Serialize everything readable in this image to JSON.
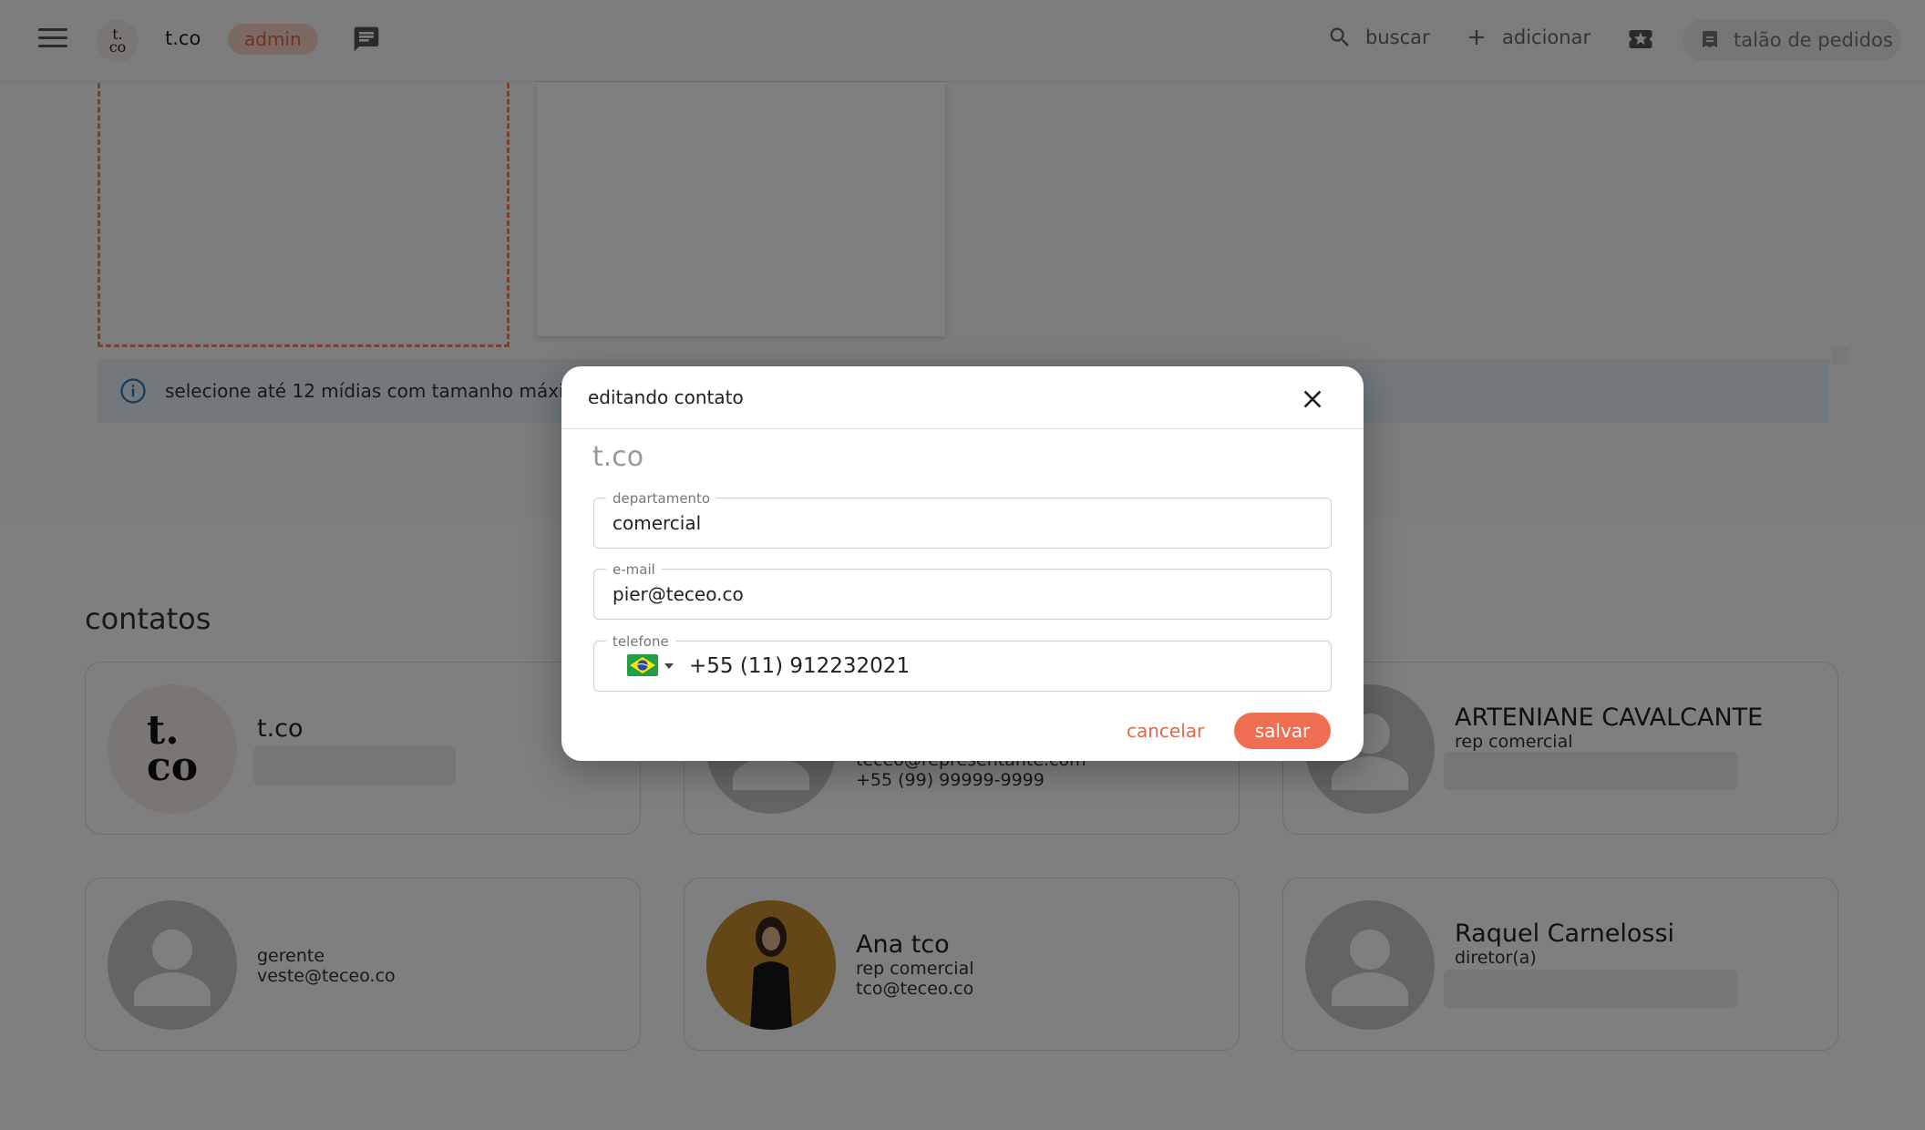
{
  "header": {
    "logo": "t.\nco",
    "brand": "t.co",
    "role_badge": "admin",
    "search_label": "buscar",
    "add_label": "adicionar",
    "orders_label": "talão de pedidos"
  },
  "upload": {
    "info_text": "selecione até 12 mídias com tamanho máximo"
  },
  "contacts": {
    "title": "contatos",
    "cards": [
      {
        "name": "t.co",
        "role": "",
        "email": "",
        "phone": ""
      },
      {
        "name": "",
        "role": "",
        "email": "teceo@representante.com",
        "phone": "+55 (99) 99999-9999"
      },
      {
        "name": "ARTENIANE CAVALCANTE",
        "role": "rep comercial",
        "email": "",
        "phone": ""
      },
      {
        "name": "",
        "role": "gerente",
        "email": "veste@teceo.co",
        "phone": ""
      },
      {
        "name": "Ana tco",
        "role": "rep comercial",
        "email": "tco@teceo.co",
        "phone": ""
      },
      {
        "name": "Raquel Carnelossi",
        "role": "diretor(a)",
        "email": "",
        "phone": ""
      }
    ]
  },
  "dialog": {
    "title": "editando contato",
    "org": "t.co",
    "department_label": "departamento",
    "department_value": "comercial",
    "email_label": "e-mail",
    "email_value": "pier@teceo.co",
    "phone_label": "telefone",
    "phone_value": "+55 (11) 912232021",
    "cancel_label": "cancelar",
    "save_label": "salvar"
  },
  "colors": {
    "accent": "#ef6d51",
    "badge_bg": "#fbd3c9",
    "info_bg": "#e4f1f8"
  }
}
